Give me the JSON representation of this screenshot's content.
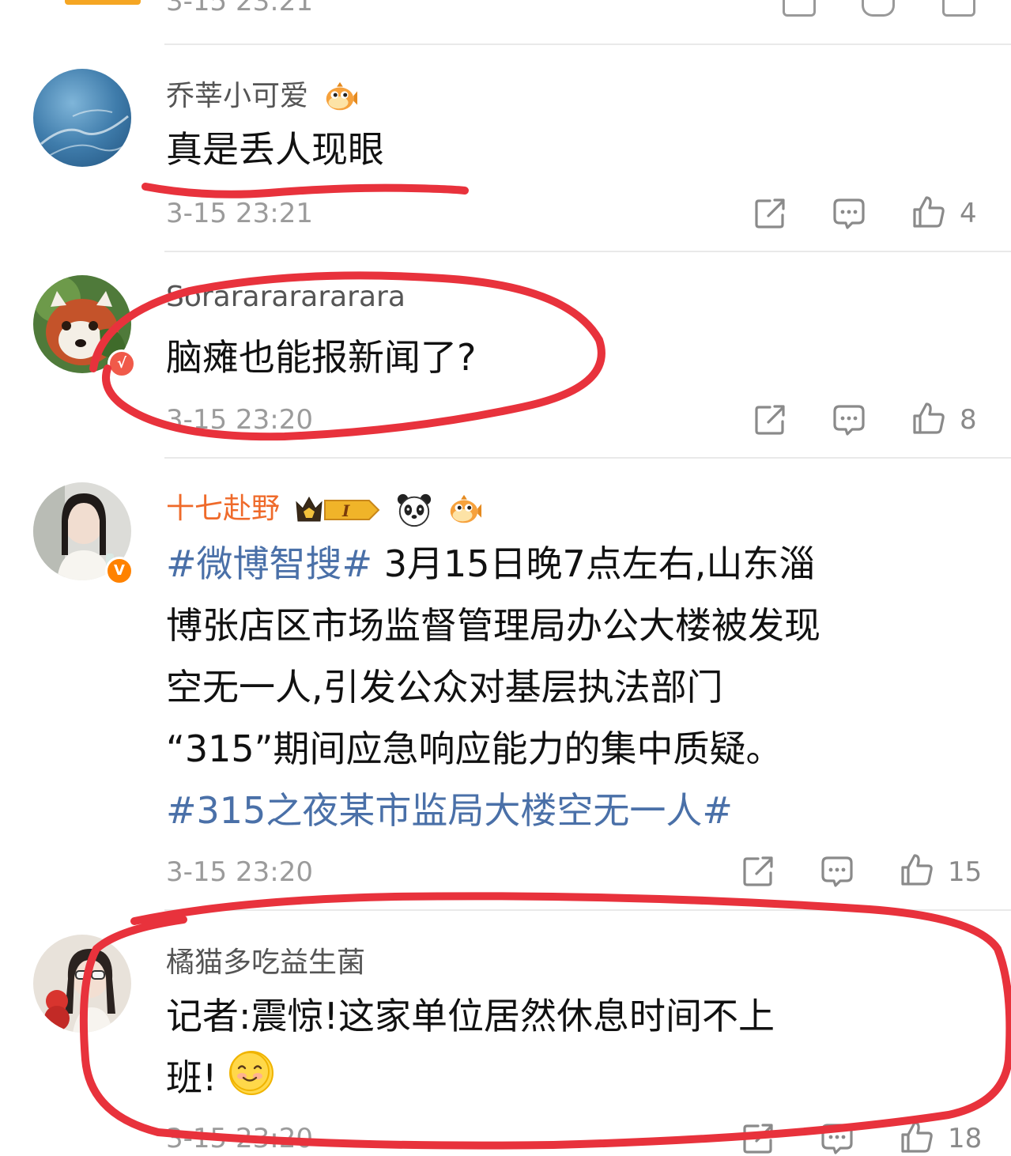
{
  "top_partial": {
    "time": "3-15 23:21"
  },
  "comments": [
    {
      "username": "乔莘小可爱",
      "text": "真是丢人现眼",
      "time": "3-15 23:21",
      "likes": "4"
    },
    {
      "username": "Sorarararararara",
      "text": "脑瘫也能报新闻了?",
      "time": "3-15 23:20",
      "likes": "8"
    },
    {
      "username": "十七赴野",
      "level_badge": "I",
      "lines": [
        {
          "tag": "#微博智搜#",
          "rest": " 3月15日晚7点左右,山东淄"
        },
        {
          "text": "博张店区市场监督管理局办公大楼被发现"
        },
        {
          "text": "空无一人,引发公众对基层执法部门"
        },
        {
          "text": "“315”期间应急响应能力的集中质疑。"
        },
        {
          "tag": "#315之夜某市监局大楼空无一人#"
        }
      ],
      "time": "3-15 23:20",
      "likes": "15"
    },
    {
      "username": "橘猫多吃益生菌",
      "line1": "记者:震惊!这家单位居然休息时间不上",
      "line2": "班!",
      "time": "3-15 23:20",
      "likes": "18"
    }
  ],
  "icons": {
    "share": "share-icon",
    "comment": "comment-icon",
    "like": "like-icon",
    "emoji": "pufferfish-emoji-icon",
    "panda": "panda-emoji-icon",
    "crown": "crown-badge-icon",
    "smile": "smile-emoji-icon",
    "verified": "verified-v-icon"
  },
  "colors": {
    "link": "#4a70a8",
    "vip_name": "#ef6a2a",
    "annotation": "#e8323c",
    "verified": "#ff8200"
  }
}
